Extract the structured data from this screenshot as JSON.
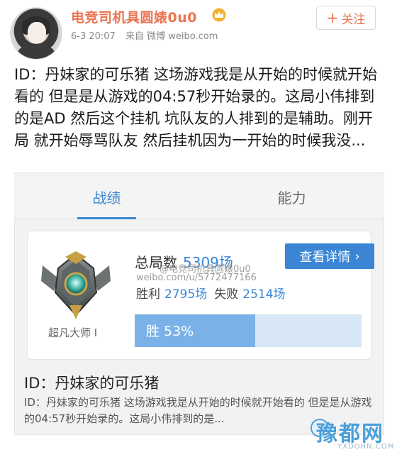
{
  "post": {
    "username": "电竞司机具圆婊0u0",
    "date": "6-3 20:07",
    "source": "来自 微博 weibo.com",
    "follow_label": "关注",
    "text": "ID：丹妹家的可乐猪 这场游戏我是从开始的时候就开始看的 但是是从游戏的04:57秒开始录的。这局小伟排到的是AD 然后这个挂机 坑队友的人排到的是辅助。刚开局 就开始辱骂队友 然后挂机因为一开始的时候我没..."
  },
  "card": {
    "tabs": [
      {
        "label": "战绩",
        "active": true
      },
      {
        "label": "能力",
        "active": false
      }
    ],
    "stats": {
      "total_label": "总局数",
      "total_value": "5309场",
      "detail_button": "查看详情",
      "win_label": "胜利",
      "win_value": "2795场",
      "loss_label": "失败",
      "loss_value": "2514场",
      "win_rate_label": "胜 53%",
      "win_rate": 0.53,
      "rank_label": "超凡大师 I"
    },
    "watermark_name": "@电竞司机具圆婊0u0",
    "watermark_url": "weibo.com/u/5772477166",
    "title": "ID：丹妹家的可乐猪",
    "description": "ID：丹妹家的可乐猪  这场游戏我是从开始的时候就开始看的  但是是从游戏的04:57秒开始录的。这局小伟排到的是..."
  },
  "site_watermark": {
    "cn": "豫都网",
    "en": "YXDOHN.COM"
  },
  "colors": {
    "username": "#eb7350",
    "accent_blue": "#3a86d4",
    "win_bar": "#7ab1e8",
    "win_bar_track": "#d7e7f6"
  }
}
